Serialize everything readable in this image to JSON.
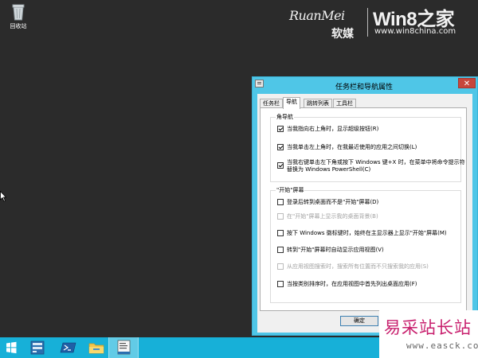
{
  "desktop": {
    "recycle_bin_label": "回收站"
  },
  "watermark_top": {
    "ruanmei": "RuanMei",
    "ruanmei_cn": "软媒",
    "win8": "Win8之家",
    "url": "www.win8china.com"
  },
  "window": {
    "title": "任务栏和导航属性",
    "close_symbol": "✕",
    "tabs": [
      {
        "label": "任务栏",
        "active": false
      },
      {
        "label": "导航",
        "active": true
      },
      {
        "label": "跳转列表",
        "active": false
      },
      {
        "label": "工具栏",
        "active": false
      }
    ],
    "corner_group": {
      "title": "角导航",
      "options": [
        {
          "text": "当我指向右上角时，显示超级按钮(R)",
          "checked": true,
          "disabled": false
        },
        {
          "text": "当我单击左上角时，在我最近使用的应用之间切换(L)",
          "checked": true,
          "disabled": false
        },
        {
          "line1": "当我右键单击左下角或按下 Windows 键+X 时，在菜单中将命令提示符",
          "line2": "替换为 Windows PowerShell(C)",
          "checked": true,
          "disabled": false
        }
      ]
    },
    "start_group": {
      "title": "\"开始\"屏幕",
      "options": [
        {
          "text": "登录后转到桌面而不是\"开始\"屏幕(D)",
          "checked": false,
          "disabled": false
        },
        {
          "text": "在\"开始\"屏幕上显示我的桌面背景(B)",
          "checked": false,
          "disabled": true
        },
        {
          "text": "按下 Windows 徽标键时，始终在主显示器上显示\"开始\"屏幕(M)",
          "checked": false,
          "disabled": false
        },
        {
          "text": "转到\"开始\"屏幕时自动显示应用视图(V)",
          "checked": false,
          "disabled": false
        },
        {
          "text": "从应用视图搜索时，搜索所有位置而不只搜索我的应用(S)",
          "checked": false,
          "disabled": true
        },
        {
          "text": "当按类别排序时，在应用视图中首先列出桌面应用(F)",
          "checked": false,
          "disabled": false
        }
      ]
    },
    "ok_label": "确定",
    "cancel_label": ""
  },
  "watermark_bottom": {
    "title": "易采站长站",
    "url": "www.easck.com"
  },
  "colors": {
    "window_frame": "#4fc6e7",
    "taskbar": "#17b0d8",
    "desktop": "#2b2b2b",
    "close_button": "#c7463c"
  },
  "taskbar": {
    "icons": [
      "windows-logo-icon",
      "server-manager-icon",
      "powershell-icon",
      "file-explorer-icon",
      "taskbar-properties-icon"
    ]
  }
}
